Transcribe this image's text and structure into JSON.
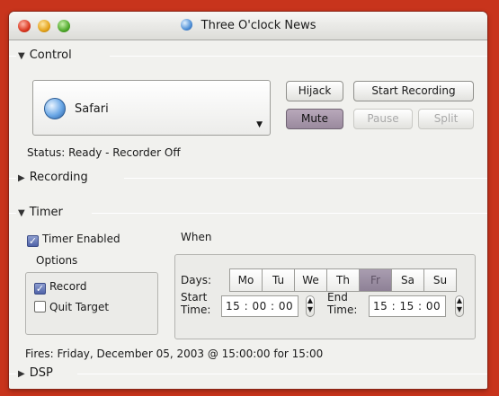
{
  "window": {
    "title": "Three O'clock News"
  },
  "sections": {
    "control": "Control",
    "recording": "Recording",
    "timer": "Timer",
    "dsp": "DSP"
  },
  "control": {
    "source_app": "Safari",
    "buttons": {
      "hijack": "Hijack",
      "start_recording": "Start Recording",
      "mute": "Mute",
      "pause": "Pause",
      "split": "Split"
    },
    "status": "Status:  Ready - Recorder Off"
  },
  "timer": {
    "timer_enabled_label": "Timer Enabled",
    "timer_enabled": true,
    "options_label": "Options",
    "record_label": "Record",
    "record_checked": true,
    "quit_target_label": "Quit Target",
    "quit_target_checked": false,
    "when_label": "When",
    "days_label": "Days:",
    "days": [
      "Mo",
      "Tu",
      "We",
      "Th",
      "Fr",
      "Sa",
      "Su"
    ],
    "selected_day": "Fr",
    "start_label_line1": "Start",
    "start_label_line2": "Time:",
    "start_time": "15 : 00 : 00",
    "end_label_line1": "End",
    "end_label_line2": "Time:",
    "end_time": "15 : 15 : 00",
    "fires": "Fires:  Friday, December 05, 2003 @ 15:00:00 for 15:00"
  },
  "icons": {
    "title": "safari-globe-icon",
    "app": "safari-icon"
  },
  "colors": {
    "background": "#c8341c",
    "pressed_button": "#9a8a9e",
    "selected_day": "#8e8196"
  }
}
